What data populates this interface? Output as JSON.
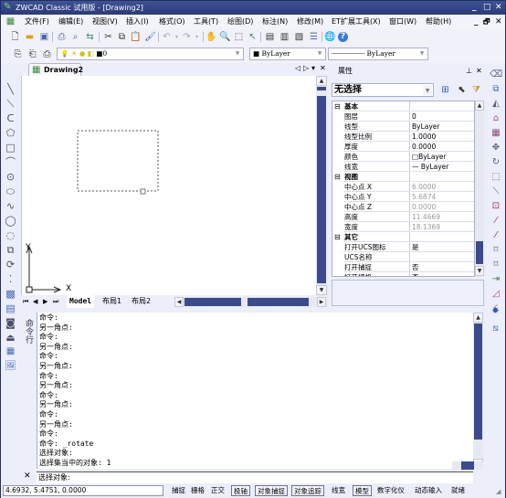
{
  "app": {
    "title": "ZWCAD Classic 试用版 - [Drawing2]",
    "window_controls": [
      "_",
      "□",
      "✕"
    ]
  },
  "menu": {
    "items": [
      "文件(F)",
      "编辑(E)",
      "视图(V)",
      "插入(I)",
      "格式(O)",
      "工具(T)",
      "绘图(D)",
      "标注(N)",
      "修改(M)",
      "ET扩展工具(X)",
      "窗口(W)",
      "帮助(H)"
    ],
    "mdi_controls": [
      "_",
      "🗗",
      "✕"
    ]
  },
  "toolbar": {
    "layer_value": "0",
    "color_value": "ByLayer",
    "linetype_value": "ByLayer"
  },
  "document": {
    "tab_label": "Drawing2",
    "tab_controls": [
      "◁",
      "▷",
      "▾",
      "✕"
    ],
    "ucs_x": "X",
    "ucs_y": "Y",
    "layout_tabs": [
      "Model",
      "布局1",
      "布局2"
    ],
    "nav_buttons": [
      "⏮",
      "◀",
      "▶",
      "⏭"
    ]
  },
  "properties": {
    "title": "属性",
    "selection": "无选择",
    "rows": [
      {
        "type": "cat",
        "key": "基本",
        "value": ""
      },
      {
        "type": "row",
        "key": "图层",
        "value": "0"
      },
      {
        "type": "row",
        "key": "线型",
        "value": "ByLayer"
      },
      {
        "type": "row",
        "key": "线型比例",
        "value": "1.0000"
      },
      {
        "type": "row",
        "key": "厚度",
        "value": "0.0000"
      },
      {
        "type": "row",
        "key": "颜色",
        "value": "□ByLayer"
      },
      {
        "type": "row",
        "key": "线宽",
        "value": "— ByLayer"
      },
      {
        "type": "cat",
        "key": "视图",
        "value": ""
      },
      {
        "type": "ro",
        "key": "中心点 X",
        "value": "6.0000"
      },
      {
        "type": "ro",
        "key": "中心点 Y",
        "value": "5.6874"
      },
      {
        "type": "ro",
        "key": "中心点 Z",
        "value": "0.0000"
      },
      {
        "type": "ro",
        "key": "高度",
        "value": "11.4669"
      },
      {
        "type": "ro",
        "key": "宽度",
        "value": "18.1369"
      },
      {
        "type": "cat",
        "key": "其它",
        "value": ""
      },
      {
        "type": "row",
        "key": "打开UCS图标",
        "value": "是"
      },
      {
        "type": "row",
        "key": "UCS名称",
        "value": ""
      },
      {
        "type": "row",
        "key": "打开捕捉",
        "value": "否"
      },
      {
        "type": "row",
        "key": "打开栅格",
        "value": "否"
      }
    ]
  },
  "command": {
    "label": "命令行",
    "history": [
      "命令:",
      "另一角点:",
      "命令:",
      "另一角点:",
      "命令:",
      "另一角点:",
      "命令:",
      "另一角点:",
      "命令:",
      "另一角点:",
      "命令:",
      "另一角点:",
      "命令:",
      "命令: _rotate",
      "选择对象:",
      "选择集当中的对象: 1"
    ],
    "prompt": "选择对象:"
  },
  "status": {
    "coords": "4.6932,  5.4751,  0.0000",
    "buttons": [
      {
        "label": "捕捉",
        "on": false
      },
      {
        "label": "栅格",
        "on": false
      },
      {
        "label": "正交",
        "on": false
      },
      {
        "label": "极轴",
        "on": true
      },
      {
        "label": "对象捕捉",
        "on": true
      },
      {
        "label": "对象追踪",
        "on": true
      },
      {
        "label": "线宽",
        "on": false
      },
      {
        "label": "模型",
        "on": true
      },
      {
        "label": "数字化仪",
        "on": false
      },
      {
        "label": "动态输入",
        "on": false
      },
      {
        "label": "就绪",
        "on": false
      }
    ]
  }
}
